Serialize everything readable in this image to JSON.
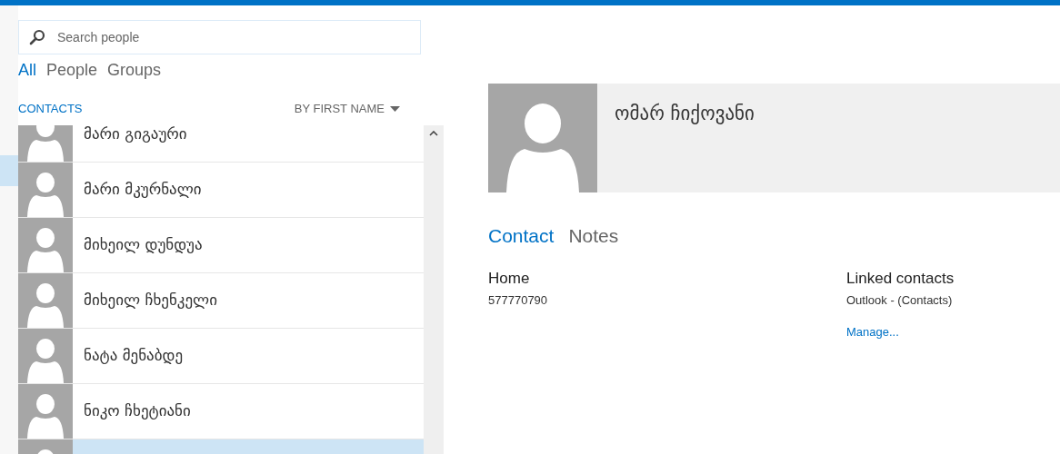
{
  "search": {
    "placeholder": "Search people"
  },
  "filters": [
    {
      "label": "All",
      "selected": true
    },
    {
      "label": "People",
      "selected": false
    },
    {
      "label": "Groups",
      "selected": false
    }
  ],
  "list_header": {
    "title": "CONTACTS",
    "sort": "BY FIRST NAME"
  },
  "contacts": [
    {
      "name": "მარი გიგაური",
      "selected": false
    },
    {
      "name": "მარი მკურნალი",
      "selected": false
    },
    {
      "name": "მიხეილ დუნდუა",
      "selected": false
    },
    {
      "name": "მიხეილ ჩხენკელი",
      "selected": false
    },
    {
      "name": "ნატა მენაბდე",
      "selected": false
    },
    {
      "name": "ნიკო ჩხეტიანი",
      "selected": false
    },
    {
      "selected": true
    }
  ],
  "detail": {
    "name": "ომარ ჩიქოვანი",
    "tabs": [
      {
        "label": "Contact",
        "selected": true
      },
      {
        "label": "Notes",
        "selected": false
      }
    ],
    "phone": {
      "label": "Home",
      "value": "577770790"
    },
    "linked": {
      "label": "Linked contacts",
      "source": "Outlook - (Contacts)",
      "link": "Manage..."
    }
  }
}
